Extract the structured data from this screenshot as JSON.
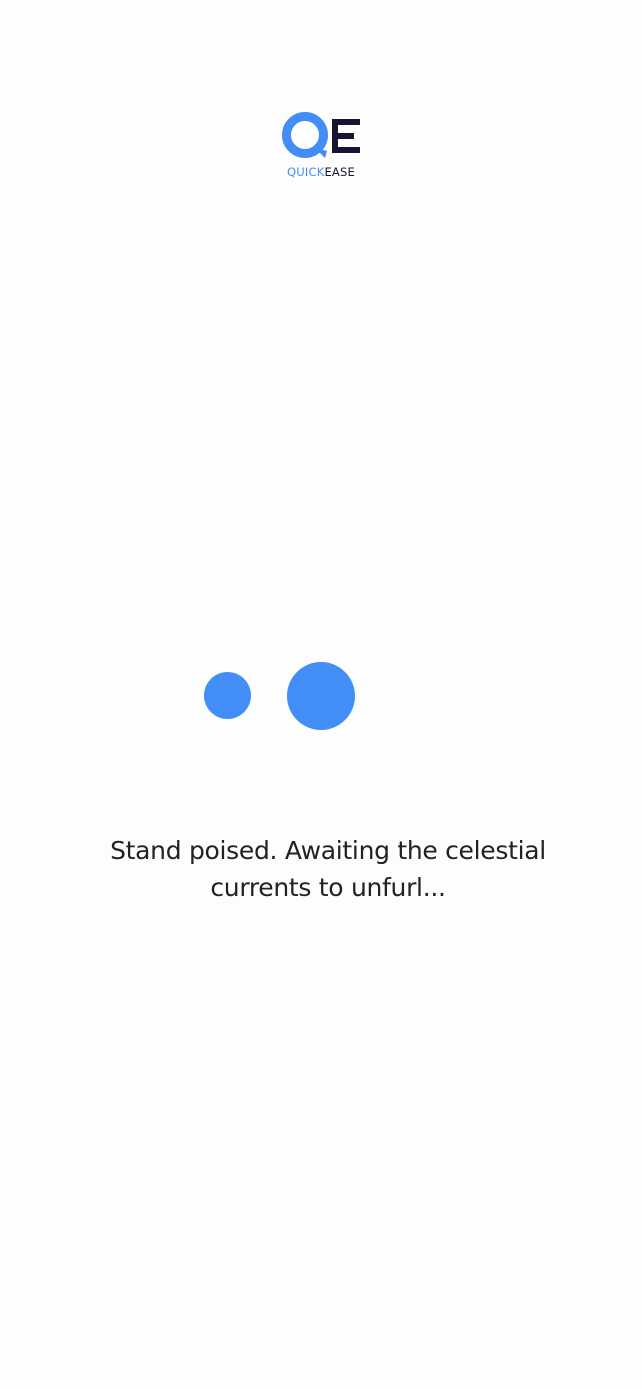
{
  "brand": {
    "logo_letters": "QE",
    "wordmark_part1": "QUICK",
    "wordmark_part2": "EASE",
    "accent_color": "#428df6",
    "dark_color": "#151532"
  },
  "loader": {
    "message": "Stand poised. Awaiting the celestial currents to unfurl..."
  }
}
